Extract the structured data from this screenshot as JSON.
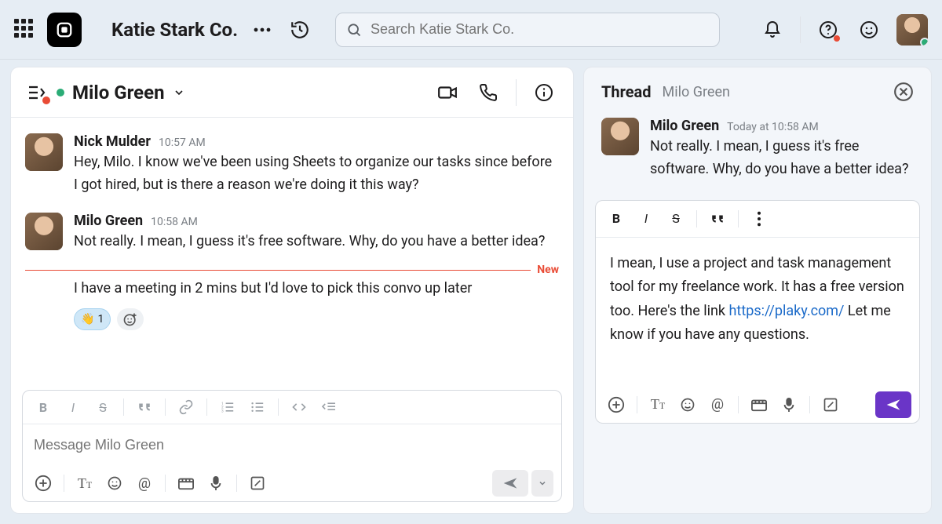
{
  "topbar": {
    "org_name": "Katie Stark Co.",
    "search_placeholder": "Search Katie Stark Co."
  },
  "chat": {
    "title": "Milo Green",
    "messages": [
      {
        "author": "Nick Mulder",
        "time": "10:57 AM",
        "text": "Hey, Milo. I know we've been using Sheets to organize our tasks since before I got hired, but is there a reason we're doing it this way?"
      },
      {
        "author": "Milo Green",
        "time": "10:58 AM",
        "text": "Not really. I mean, I guess it's free software. Why, do you have a better idea?"
      }
    ],
    "divider_label": "New",
    "continued_text": "I have a meeting in 2 mins but I'd love to pick this convo up later",
    "reaction_count": "1",
    "composer_placeholder": "Message Milo Green"
  },
  "thread": {
    "title": "Thread",
    "subtitle": "Milo Green",
    "message": {
      "author": "Milo Green",
      "time": "Today at 10:58 AM",
      "text": "Not really. I mean, I guess it's free software. Why, do you have a better idea?"
    },
    "draft_pre": "I mean, I use a project and task management tool for my freelance work. It has a free version too. Here's the link ",
    "draft_link": "https://plaky.com/",
    "draft_post": " Let me know if you have any questions."
  }
}
